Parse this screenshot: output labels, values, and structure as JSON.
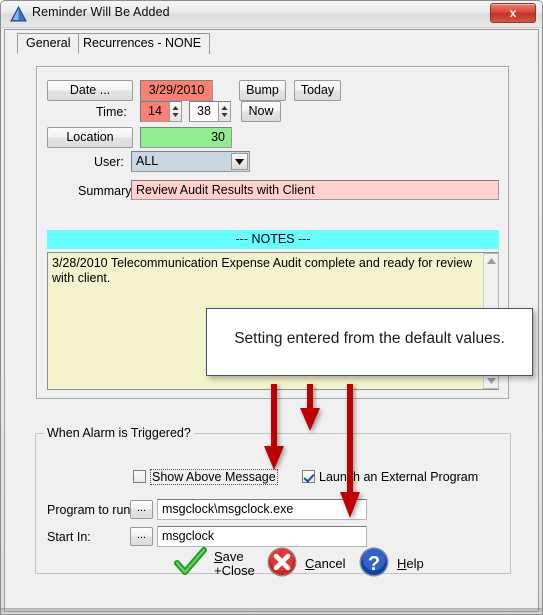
{
  "window": {
    "title": "Reminder Will Be Added",
    "icon": "blue-triangle-icon",
    "close_label": "x"
  },
  "tabs": [
    {
      "label": "General",
      "active": true
    },
    {
      "label": "Recurrences - NONE",
      "active": false
    }
  ],
  "form": {
    "date_button": "Date ...",
    "date_value": "3/29/2010",
    "bump_button": "Bump",
    "today_button": "Today",
    "time_label": "Time:",
    "time_hour": "14",
    "time_minute": "38",
    "now_button": "Now",
    "location_button": "Location",
    "location_value": "30",
    "user_label": "User:",
    "user_value": "ALL",
    "summary_label": "Summary:",
    "summary_value": "Review Audit Results with Client",
    "notes_header": "--- NOTES ---",
    "notes_value": "3/28/2010 Telecommunication Expense Audit complete and ready for review with client."
  },
  "alarm": {
    "group_title": "When Alarm is Triggered?",
    "show_above_message_label": "Show Above Message",
    "show_above_message_checked": false,
    "launch_external_label": "Launch an External Program",
    "launch_external_checked": true,
    "program_to_run_label": "Program to run:",
    "program_to_run_value": "msgclock\\msgclock.exe",
    "start_in_label": "Start In:",
    "start_in_value": "msgclock",
    "browse_button": "..."
  },
  "footer": {
    "save_line1": "Save",
    "save_line2": "+Close",
    "save_accel": "S",
    "cancel_label": "Cancel",
    "cancel_accel": "C",
    "help_label": "Help",
    "help_accel": "H"
  },
  "annotation": {
    "callout_text": "Setting entered from the default values.",
    "arrow_color": "#C00000",
    "callout_border": "#44546A"
  },
  "colors": {
    "date_field_bg": "#FA8072",
    "hour_field_bg": "#FA8072",
    "location_field_bg": "#90EE90",
    "summary_field_bg": "#FFD0CD",
    "notes_header_bg": "#66FFFF",
    "notes_body_bg": "#F2F2CD",
    "dropdown_bg": "#CAD6E0",
    "window_bg": "#F0F0F0"
  }
}
